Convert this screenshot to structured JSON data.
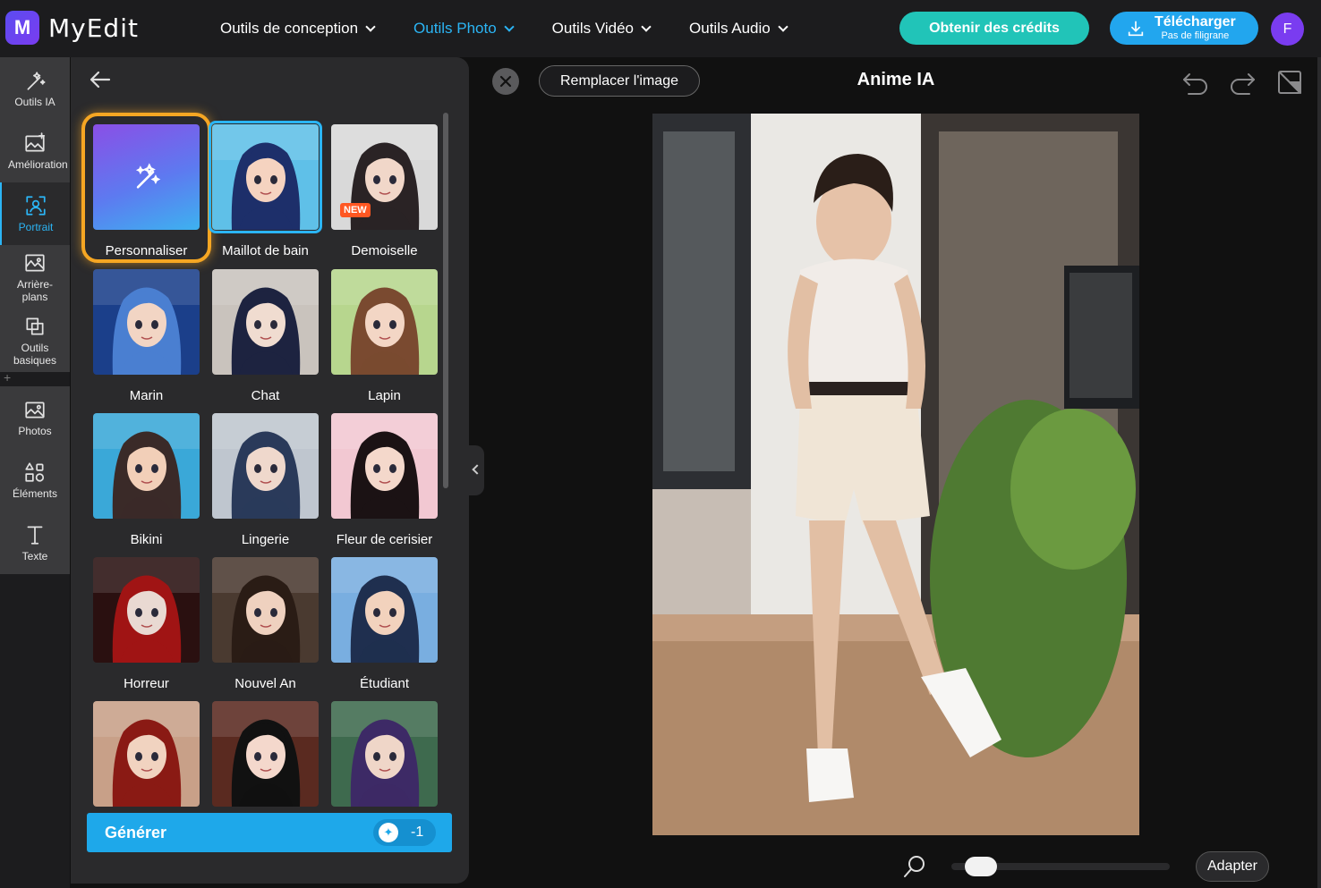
{
  "app": {
    "logo_letter": "M",
    "name": "MyEdit"
  },
  "nav": [
    {
      "label": "Outils de conception",
      "active": false
    },
    {
      "label": "Outils Photo",
      "active": true
    },
    {
      "label": "Outils Vidéo",
      "active": false
    },
    {
      "label": "Outils Audio",
      "active": false
    }
  ],
  "header": {
    "credits_label": "Obtenir des crédits",
    "download_label": "Télécharger",
    "download_sub": "Pas de filigrane",
    "avatar_initial": "F"
  },
  "rail": [
    {
      "label": "Outils IA",
      "icon": "magic-wand-icon"
    },
    {
      "label": "Amélioration",
      "icon": "image-enhance-icon"
    },
    {
      "label": "Portrait",
      "icon": "portrait-icon",
      "active": true
    },
    {
      "label": "Arrière-plans",
      "icon": "background-icon"
    },
    {
      "label": "Outils basiques",
      "icon": "crop-icon"
    },
    {
      "label": "Photos",
      "icon": "photo-icon"
    },
    {
      "label": "Éléments",
      "icon": "elements-icon"
    },
    {
      "label": "Texte",
      "icon": "text-icon"
    }
  ],
  "styles": [
    {
      "label": "Personnaliser",
      "kind": "custom"
    },
    {
      "label": "Maillot de bain",
      "selected": true,
      "colors": [
        "#5fc0e8",
        "#1d2f6a",
        "#f5d3c0"
      ]
    },
    {
      "label": "Demoiselle",
      "badge": "NEW",
      "colors": [
        "#d9d9d9",
        "#2a2325",
        "#f1d7c9"
      ]
    },
    {
      "label": "Marin",
      "colors": [
        "#1b3f8a",
        "#4a7fd1",
        "#f2d5c4"
      ]
    },
    {
      "label": "Chat",
      "colors": [
        "#c9c3bd",
        "#1d2340",
        "#f0dcd0"
      ]
    },
    {
      "label": "Lapin",
      "colors": [
        "#b7d68e",
        "#7a4a30",
        "#f3d6c5"
      ]
    },
    {
      "label": "Bikini",
      "colors": [
        "#3aa8d8",
        "#3a2a28",
        "#f2cfb8"
      ]
    },
    {
      "label": "Lingerie",
      "colors": [
        "#bfc6cf",
        "#2a3a5a",
        "#efd8cc"
      ]
    },
    {
      "label": "Fleur de cerisier",
      "colors": [
        "#f2c8d2",
        "#1b1214",
        "#f4d8cb"
      ]
    },
    {
      "label": "Horreur",
      "colors": [
        "#2a1010",
        "#a01414",
        "#e9d9d2"
      ]
    },
    {
      "label": "Nouvel An",
      "colors": [
        "#4a3a30",
        "#2a1c15",
        "#efd1bf"
      ]
    },
    {
      "label": "Étudiant",
      "colors": [
        "#79aee0",
        "#1f2f4f",
        "#f2d2bd"
      ]
    },
    {
      "label": "",
      "colors": [
        "#c8a088",
        "#8a1a14",
        "#f1d3c0"
      ]
    },
    {
      "label": "",
      "colors": [
        "#5a2a20",
        "#111111",
        "#f4d8cc"
      ]
    },
    {
      "label": "",
      "colors": [
        "#3e6a4e",
        "#3d2a66",
        "#efd6c8"
      ]
    }
  ],
  "generate": {
    "label": "Générer",
    "cost": "-1"
  },
  "canvas": {
    "replace_label": "Remplacer l'image",
    "title": "Anime IA",
    "fit_label": "Adapter",
    "zoom_level": 0.07
  }
}
